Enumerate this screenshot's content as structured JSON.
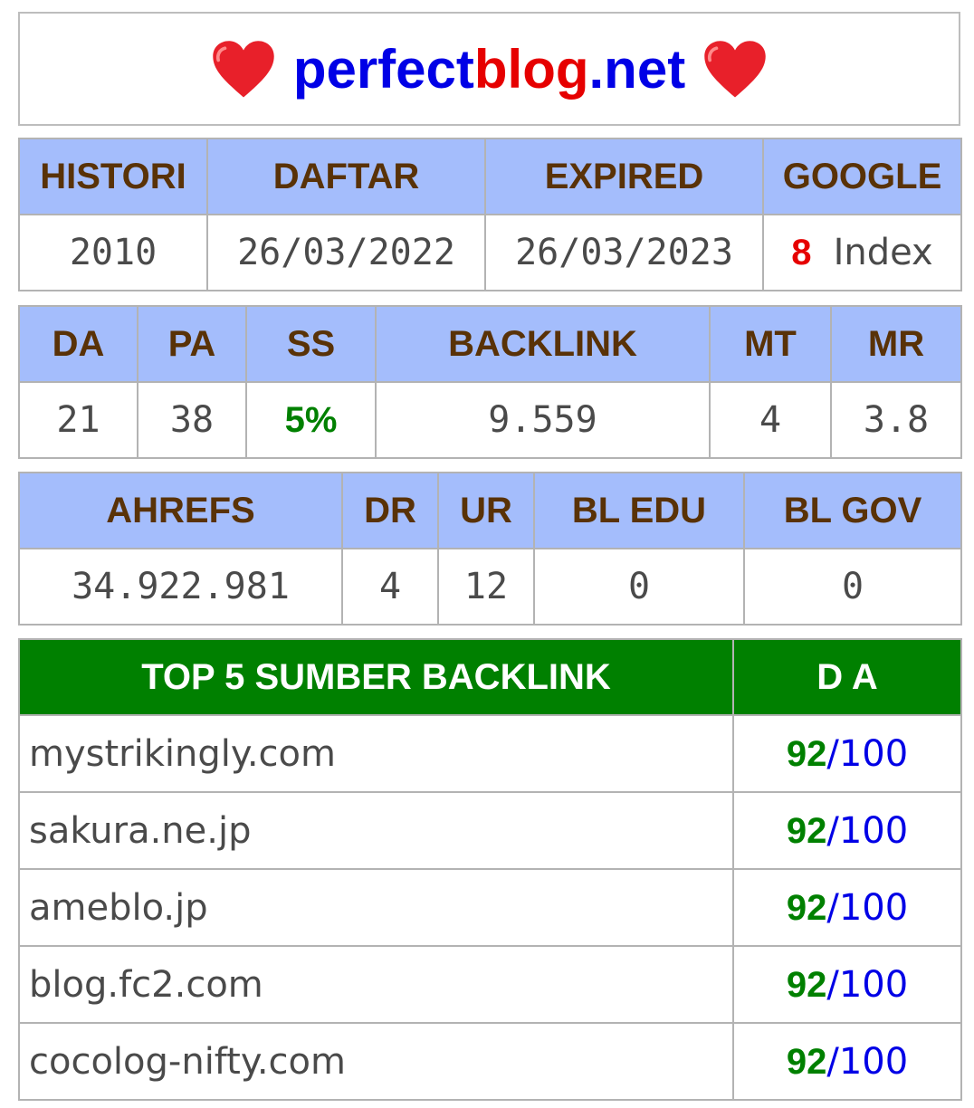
{
  "title": {
    "part1": "perfect",
    "part2": "blog",
    "part3": ".net",
    "heart_icon": "heart-icon"
  },
  "table1": {
    "headers": [
      "HISTORI",
      "DAFTAR",
      "EXPIRED",
      "GOOGLE"
    ],
    "values": {
      "histori": "2010",
      "daftar": "26/03/2022",
      "expired": "26/03/2023",
      "google_count": "8",
      "google_label": "Index"
    }
  },
  "table2": {
    "headers": [
      "DA",
      "PA",
      "SS",
      "BACKLINK",
      "MT",
      "MR"
    ],
    "values": [
      "21",
      "38",
      "5%",
      "9.559",
      "4",
      "3.8"
    ]
  },
  "table3": {
    "headers": [
      "AHREFS",
      "DR",
      "UR",
      "BL EDU",
      "BL GOV"
    ],
    "values": [
      "34.922.981",
      "4",
      "12",
      "0",
      "0"
    ]
  },
  "top_backlinks": {
    "header_source": "TOP 5 SUMBER BACKLINK",
    "header_da": "D A",
    "rows": [
      {
        "site": "mystrikingly.com",
        "da": "92",
        "sep": "/",
        "max": "100"
      },
      {
        "site": "sakura.ne.jp",
        "da": "92",
        "sep": "/",
        "max": "100"
      },
      {
        "site": "ameblo.jp",
        "da": "92",
        "sep": "/",
        "max": "100"
      },
      {
        "site": "blog.fc2.com",
        "da": "92",
        "sep": "/",
        "max": "100"
      },
      {
        "site": "cocolog-nifty.com",
        "da": "92",
        "sep": "/",
        "max": "100"
      }
    ]
  },
  "colors": {
    "header_bg": "#a4bdfc",
    "header_text": "#593207",
    "top_header_bg": "#008000",
    "blue": "#0000e6",
    "red": "#e60000",
    "green": "#008000"
  }
}
